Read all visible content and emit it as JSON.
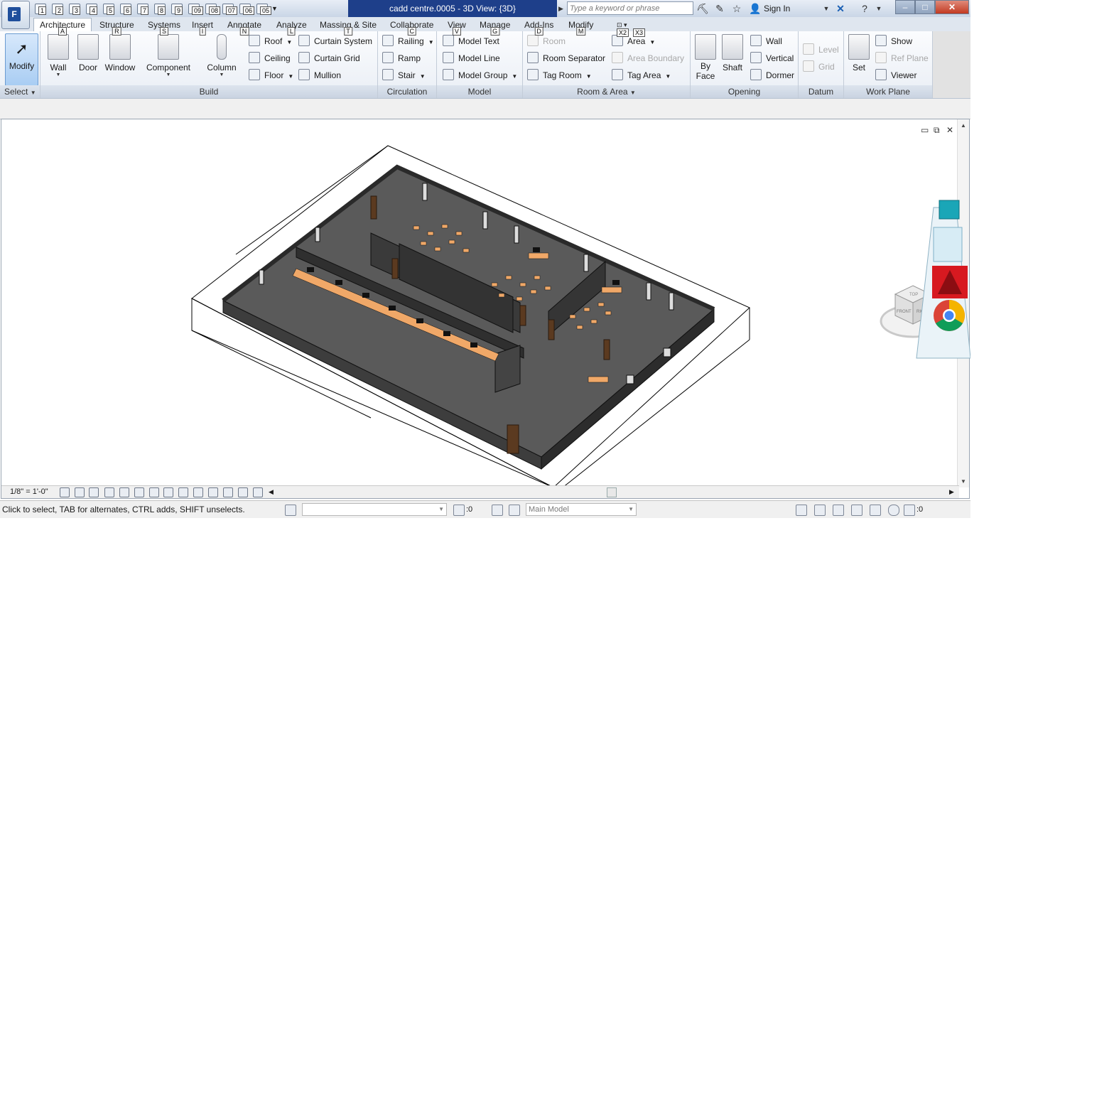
{
  "title_bar": {
    "window_title": "cadd centre.0005 - 3D View: {3D}",
    "search_placeholder": "Type a keyword or phrase",
    "sign_in": "Sign In",
    "app_letter": "F",
    "qat_keytips": [
      "1",
      "2",
      "3",
      "4",
      "5",
      "6",
      "7",
      "8",
      "9",
      "09",
      "08",
      "07",
      "06",
      "05"
    ],
    "minimize": "–",
    "maximize": "□",
    "close": "✕"
  },
  "tabs": [
    {
      "label": "Architecture",
      "keytip": "A",
      "active": true
    },
    {
      "label": "Structure",
      "keytip": "R"
    },
    {
      "label": "Systems",
      "keytip": "S"
    },
    {
      "label": "Insert",
      "keytip": "I"
    },
    {
      "label": "Annotate",
      "keytip": "N"
    },
    {
      "label": "Analyze",
      "keytip": "L"
    },
    {
      "label": "Massing & Site",
      "keytip": "T"
    },
    {
      "label": "Collaborate",
      "keytip": "C"
    },
    {
      "label": "View",
      "keytip": "V"
    },
    {
      "label": "Manage",
      "keytip": "G"
    },
    {
      "label": "Add-Ins",
      "keytip": "D"
    },
    {
      "label": "Modify",
      "keytip": "M"
    }
  ],
  "extra_keytips": [
    "X2",
    "X3"
  ],
  "ribbon": {
    "select": {
      "modify": "Modify",
      "title": "Select"
    },
    "build": {
      "title": "Build",
      "wall": "Wall",
      "door": "Door",
      "window": "Window",
      "component": "Component",
      "column": "Column",
      "roof": "Roof",
      "ceiling": "Ceiling",
      "floor": "Floor",
      "curtain_system": "Curtain System",
      "curtain_grid": "Curtain Grid",
      "mullion": "Mullion"
    },
    "circulation": {
      "title": "Circulation",
      "railing": "Railing",
      "ramp": "Ramp",
      "stair": "Stair"
    },
    "model": {
      "title": "Model",
      "model_text": "Model Text",
      "model_line": "Model Line",
      "model_group": "Model Group"
    },
    "room_area": {
      "title": "Room & Area",
      "room": "Room",
      "room_separator": "Room Separator",
      "tag_room": "Tag Room",
      "area": "Area",
      "area_boundary": "Area Boundary",
      "tag_area": "Tag Area"
    },
    "opening": {
      "title": "Opening",
      "by_face_1": "By",
      "by_face_2": "Face",
      "shaft": "Shaft",
      "wall": "Wall",
      "vertical": "Vertical",
      "dormer": "Dormer"
    },
    "datum": {
      "title": "Datum",
      "level": "Level",
      "grid": "Grid"
    },
    "work_plane": {
      "title": "Work Plane",
      "set": "Set",
      "show": "Show",
      "ref_plane": "Ref Plane",
      "viewer": "Viewer"
    }
  },
  "view": {
    "scale": "1/8\" = 1'-0\"",
    "viewcube": {
      "top": "TOP",
      "front": "FRONT",
      "right": "RIGHT"
    }
  },
  "status_bar": {
    "message": "Click to select, TAB for alternates, CTRL adds, SHIFT unselects.",
    "workset_count": ":0",
    "main_model": "Main Model",
    "filter_count": ":0"
  },
  "colors": {
    "title_accent": "#1e3f8a",
    "desk_orange": "#f0a868",
    "wall_dark": "#3d3d3d",
    "floor_gray": "#5a5a5a"
  }
}
